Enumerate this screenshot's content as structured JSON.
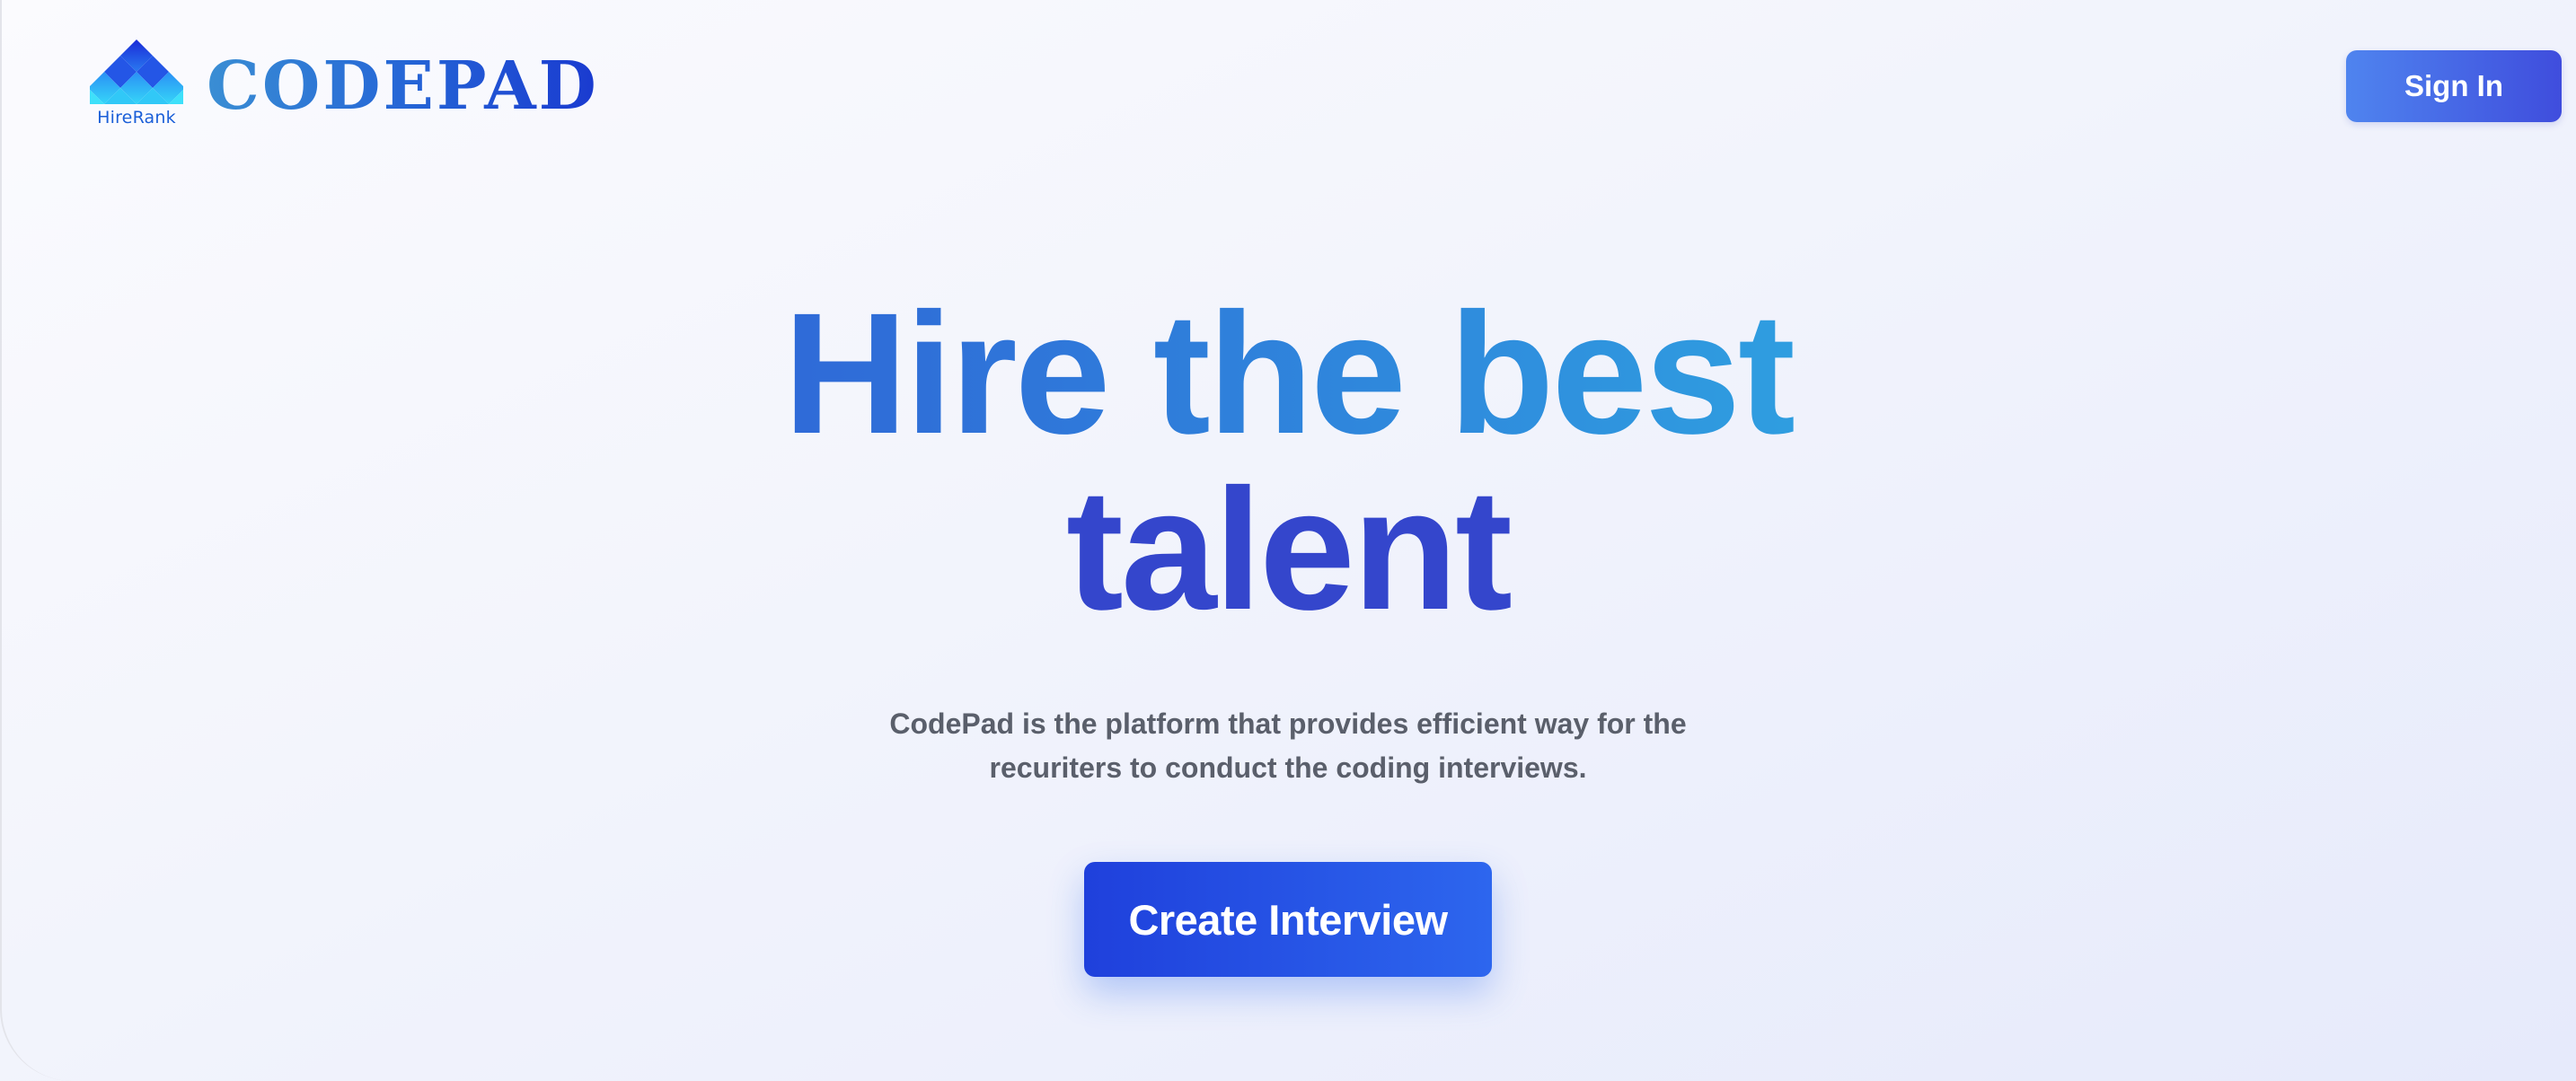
{
  "header": {
    "logo": {
      "icon": "hirerank-diamond-logo-icon",
      "subtext": "HireRank",
      "wordmark": "CODEPAD"
    },
    "signin_label": "Sign In"
  },
  "hero": {
    "title_line1": "Hire the best",
    "title_line2": "talent",
    "description_line1": "CodePad is the platform that provides efficient way for the",
    "description_line2": "recuriters to conduct the coding interviews.",
    "cta_label": "Create Interview"
  },
  "colors": {
    "brand_blue": "#1f40dc",
    "accent_cyan": "#33b8ea",
    "body_text": "#5a5f6b"
  }
}
